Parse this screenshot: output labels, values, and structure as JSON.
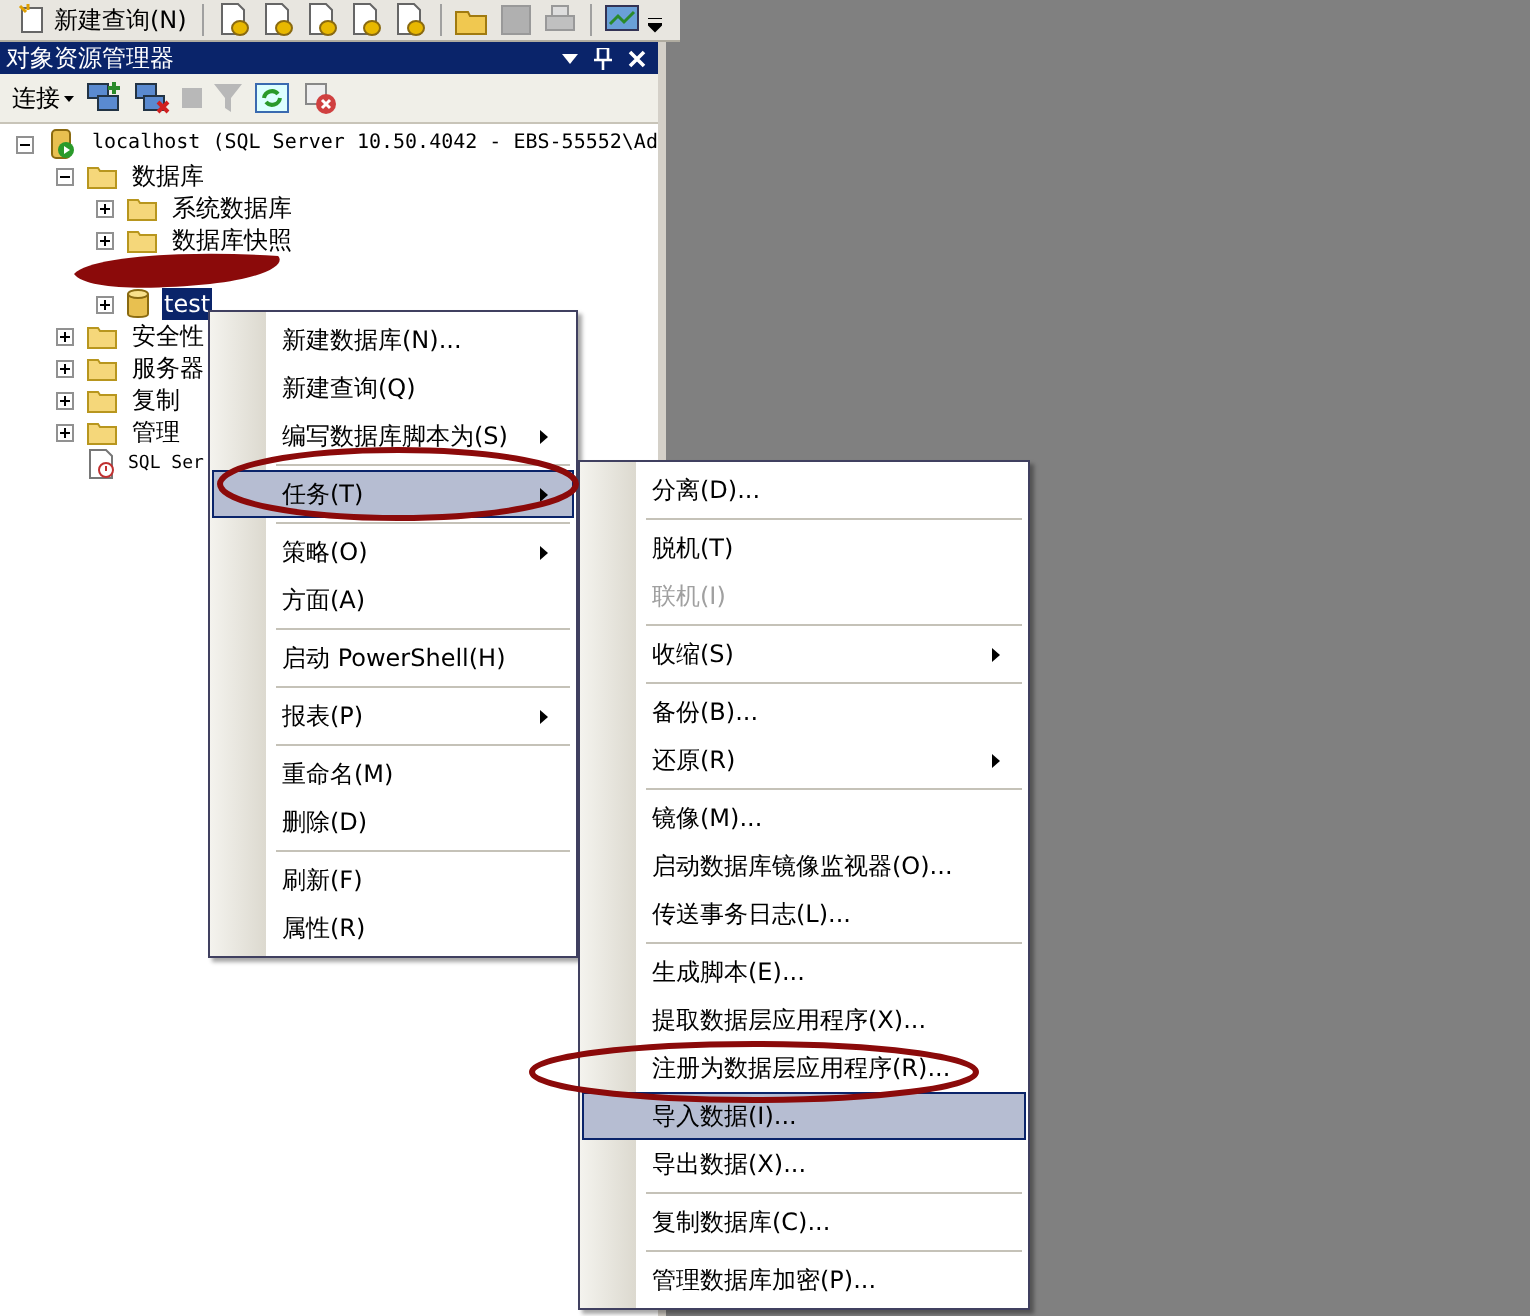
{
  "toolbar": {
    "new_query_button": "新建查询(N)"
  },
  "panel": {
    "title": "对象资源管理器",
    "connect_button": "连接"
  },
  "tree": [
    {
      "label": "localhost (SQL Server 10.50.4042 - EBS-55552\\Ad",
      "kind": "server",
      "expanded": true,
      "selected": false,
      "children": [
        {
          "label": "数据库",
          "kind": "folder",
          "expanded": true,
          "selected": false,
          "children": [
            {
              "label": "系统数据库",
              "kind": "folder",
              "expanded": false,
              "selected": false
            },
            {
              "label": "数据库快照",
              "kind": "folder",
              "expanded": false,
              "selected": false
            },
            {
              "kind": "redacted"
            },
            {
              "label": "test",
              "kind": "database",
              "expanded": false,
              "selected": true
            }
          ]
        },
        {
          "label": "安全性",
          "kind": "folder",
          "expanded": false,
          "selected": false
        },
        {
          "label": "服务器",
          "kind": "folder",
          "expanded": false,
          "selected": false
        },
        {
          "label": "复制",
          "kind": "folder",
          "expanded": false,
          "selected": false
        },
        {
          "label": "管理",
          "kind": "folder",
          "expanded": false,
          "selected": false
        },
        {
          "label": "SQL Ser",
          "kind": "agent",
          "selected": false
        }
      ]
    }
  ],
  "context_menu": [
    {
      "kind": "item",
      "label": "新建数据库(N)...",
      "submenu": false,
      "selected": false
    },
    {
      "kind": "item",
      "label": "新建查询(Q)",
      "submenu": false,
      "selected": false
    },
    {
      "kind": "item",
      "label": "编写数据库脚本为(S)",
      "submenu": true,
      "selected": false
    },
    {
      "kind": "separator"
    },
    {
      "kind": "item",
      "label": "任务(T)",
      "submenu": true,
      "selected": true
    },
    {
      "kind": "separator"
    },
    {
      "kind": "item",
      "label": "策略(O)",
      "submenu": true,
      "selected": false
    },
    {
      "kind": "item",
      "label": "方面(A)",
      "submenu": false,
      "selected": false
    },
    {
      "kind": "separator"
    },
    {
      "kind": "item",
      "label": "启动 PowerShell(H)",
      "submenu": false,
      "selected": false
    },
    {
      "kind": "separator"
    },
    {
      "kind": "item",
      "label": "报表(P)",
      "submenu": true,
      "selected": false
    },
    {
      "kind": "separator"
    },
    {
      "kind": "item",
      "label": "重命名(M)",
      "submenu": false,
      "selected": false
    },
    {
      "kind": "item",
      "label": "删除(D)",
      "submenu": false,
      "selected": false
    },
    {
      "kind": "separator"
    },
    {
      "kind": "item",
      "label": "刷新(F)",
      "submenu": false,
      "selected": false
    },
    {
      "kind": "item",
      "label": "属性(R)",
      "submenu": false,
      "selected": false
    }
  ],
  "tasks_submenu": [
    {
      "kind": "item",
      "label": "分离(D)...",
      "submenu": false,
      "selected": false,
      "disabled": false
    },
    {
      "kind": "separator"
    },
    {
      "kind": "item",
      "label": "脱机(T)",
      "submenu": false,
      "selected": false,
      "disabled": false
    },
    {
      "kind": "item",
      "label": "联机(I)",
      "submenu": false,
      "selected": false,
      "disabled": true
    },
    {
      "kind": "separator"
    },
    {
      "kind": "item",
      "label": "收缩(S)",
      "submenu": true,
      "selected": false,
      "disabled": false
    },
    {
      "kind": "separator"
    },
    {
      "kind": "item",
      "label": "备份(B)...",
      "submenu": false,
      "selected": false,
      "disabled": false
    },
    {
      "kind": "item",
      "label": "还原(R)",
      "submenu": true,
      "selected": false,
      "disabled": false
    },
    {
      "kind": "separator"
    },
    {
      "kind": "item",
      "label": "镜像(M)...",
      "submenu": false,
      "selected": false,
      "disabled": false
    },
    {
      "kind": "item",
      "label": "启动数据库镜像监视器(O)...",
      "submenu": false,
      "selected": false,
      "disabled": false
    },
    {
      "kind": "item",
      "label": "传送事务日志(L)...",
      "submenu": false,
      "selected": false,
      "disabled": false
    },
    {
      "kind": "separator"
    },
    {
      "kind": "item",
      "label": "生成脚本(E)...",
      "submenu": false,
      "selected": false,
      "disabled": false
    },
    {
      "kind": "item",
      "label": "提取数据层应用程序(X)...",
      "submenu": false,
      "selected": false,
      "disabled": false
    },
    {
      "kind": "item",
      "label": "注册为数据层应用程序(R)...",
      "submenu": false,
      "selected": false,
      "disabled": false
    },
    {
      "kind": "item",
      "label": "导入数据(I)...",
      "submenu": false,
      "selected": true,
      "disabled": false
    },
    {
      "kind": "item",
      "label": "导出数据(X)...",
      "submenu": false,
      "selected": false,
      "disabled": false
    },
    {
      "kind": "separator"
    },
    {
      "kind": "item",
      "label": "复制数据库(C)...",
      "submenu": false,
      "selected": false,
      "disabled": false
    },
    {
      "kind": "separator"
    },
    {
      "kind": "item",
      "label": "管理数据库加密(P)...",
      "submenu": false,
      "selected": false,
      "disabled": false
    }
  ]
}
